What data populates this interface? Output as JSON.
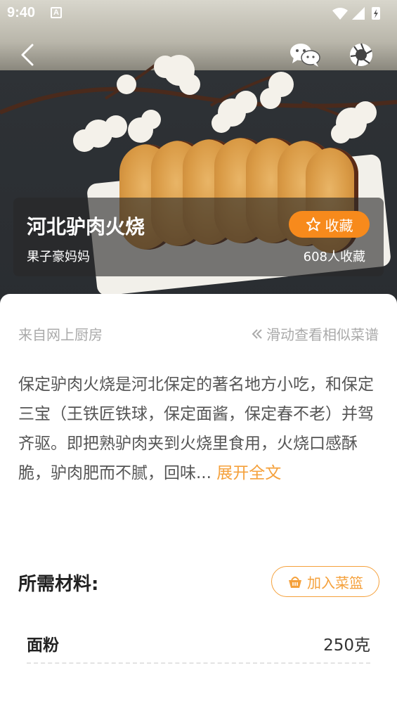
{
  "status_bar": {
    "time": "9:40",
    "notification_icon": "a-icon"
  },
  "header": {
    "back_icon": "chevron-left-icon",
    "share_wechat_icon": "wechat-icon",
    "share_moments_icon": "aperture-icon"
  },
  "recipe": {
    "title": "河北驴肉火烧",
    "author": "果子豪妈妈",
    "favorite_label": "收藏",
    "favorite_count": "608人收藏",
    "source": "来自网上厨房",
    "similar_hint": "滑动查看相似菜谱",
    "description": "保定驴肉火烧是河北保定的著名地方小吃，和保定三宝（王铁匠铁球，保定面酱，保定春不老）并驾齐驱。即把熟驴肉夹到火烧里食用，火烧口感酥脆，驴肉肥而不腻，回味...",
    "expand_label": "展开全文"
  },
  "ingredients": {
    "heading": "所需材料:",
    "add_to_basket_label": "加入菜篮",
    "items": [
      {
        "name": "面粉",
        "amount": "250克"
      }
    ]
  },
  "colors": {
    "accent": "#f78a1c",
    "link": "#f5a13c"
  }
}
